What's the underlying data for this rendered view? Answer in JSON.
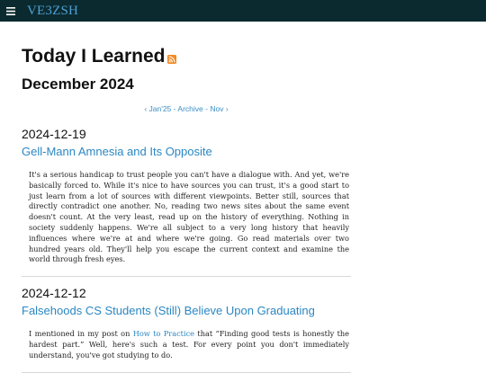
{
  "header": {
    "site_title": "VE3ZSH",
    "menu_icon": "hamburger-menu-icon",
    "background": "#0a2a30",
    "title_color": "#4fa0d4"
  },
  "page": {
    "title": "Today I Learned",
    "rss_icon": "rss-feed-icon",
    "subtitle": "December 2024"
  },
  "nav": {
    "prev": "‹ Jan'25",
    "archive": "Archive",
    "next": "Nov ›",
    "separator": "-"
  },
  "posts": [
    {
      "date": "2024-12-19",
      "title": "Gell-Mann Amnesia and Its Opposite",
      "body": "It's a serious handicap to trust people you can't have a dialogue with. And yet, we're basically forced to. While it's nice to have sources you can trust, it's a good start to just learn from a lot of sources with different viewpoints. Better still, sources that directly contradict one another. No, reading two news sites about the same event doesn't count. At the very least, read up on the history of everything. Nothing in society suddenly happens. We're all subject to a very long history that heavily influences where we're at and where we're going. Go read materials over two hundred years old. They'll help you escape the current context and examine the world through fresh eyes."
    },
    {
      "date": "2024-12-12",
      "title": "Falsehoods CS Students (Still) Believe Upon Graduating",
      "body_before_link": "I mentioned in my post on ",
      "link_text": "How to Practice",
      "body_after_link": " that “Finding good tests is honestly the hardest part.” Well, here's such a test. For every point you don't immediately understand, you've got studying to do."
    }
  ],
  "colors": {
    "link": "#2b87c2",
    "rss": "#f08a24"
  }
}
